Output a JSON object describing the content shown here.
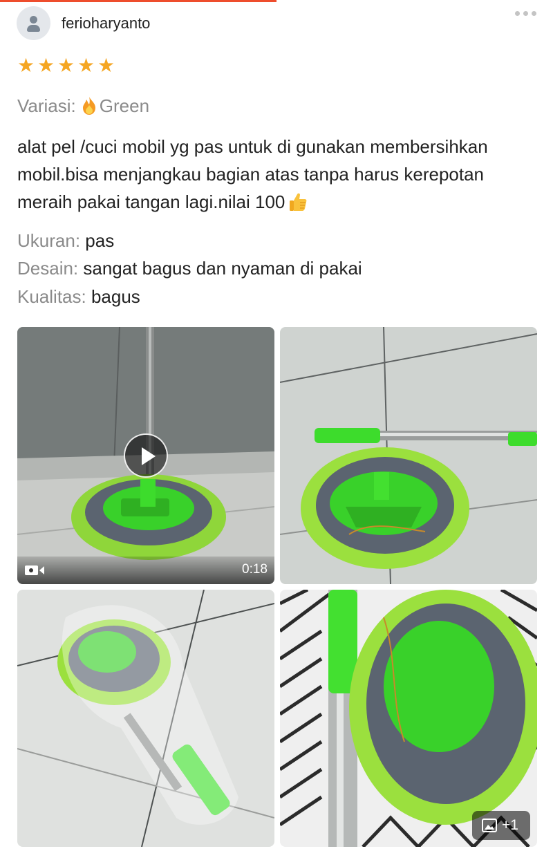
{
  "review": {
    "username": "ferioharyanto",
    "rating": 5,
    "variation_label": "Variasi:",
    "variation_value": "Green",
    "text": "alat pel /cuci mobil yg pas untuk di gunakan membersihkan mobil.bisa menjangkau bagian atas tanpa harus kerepotan meraih pakai tangan lagi.nilai 100",
    "attributes": [
      {
        "label": "Ukuran:",
        "value": "pas"
      },
      {
        "label": "Desain:",
        "value": "sangat bagus dan nyaman di pakai"
      },
      {
        "label": "Kualitas:",
        "value": "bagus"
      }
    ]
  },
  "media": {
    "video_duration": "0:18",
    "more_count": "+1"
  },
  "icons": {
    "avatar": "user-silhouette-icon",
    "menu": "more-dots-icon",
    "star": "star-icon",
    "fire": "fire-emoji-icon",
    "thumbs_up": "thumbs-up-emoji-icon",
    "play": "play-icon",
    "video": "video-camera-icon",
    "image": "image-icon"
  },
  "colors": {
    "accent": "#ee4d2d",
    "star": "#f5a623",
    "muted_text": "#8a8a8a",
    "mop_green": "#3dd62a"
  }
}
